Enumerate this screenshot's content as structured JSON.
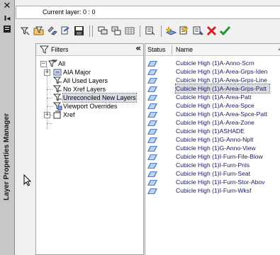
{
  "palette": {
    "title": "Layer Properties Manager"
  },
  "current_layer": "Current layer: 0 : 0",
  "toolbar": {
    "buttons": [
      "new-property-filter",
      "new-group-filter",
      "layer-states-manager",
      "new-layer",
      "new-layer-vp-frozen",
      "delete-layer",
      "set-current"
    ]
  },
  "filters": {
    "header": "Filters",
    "collapse": "«",
    "tree": [
      {
        "label": "All",
        "level": 0
      },
      {
        "label": "AIA Major",
        "level": 1
      },
      {
        "label": "All Used Layers",
        "level": 1
      },
      {
        "label": "No Xref Layers",
        "level": 1
      },
      {
        "label": "Unreconciled New Layers",
        "level": 1,
        "selected": true
      },
      {
        "label": "Viewport Overrides",
        "level": 1
      },
      {
        "label": "Xref",
        "level": 0
      }
    ]
  },
  "layers": {
    "columns": {
      "status": "Status",
      "name": "Name"
    },
    "rows": [
      {
        "name": "Cubicle High (1)A-Anno-Scrn"
      },
      {
        "name": "Cubicle High (1)A-Area-Grps-Iden"
      },
      {
        "name": "Cubicle High (1)A-Area-Grps-Line"
      },
      {
        "name": "Cubicle High (1)A-Area-Grps-Patt",
        "selected": true
      },
      {
        "name": "Cubicle High (1)A-Area-Patt"
      },
      {
        "name": "Cubicle High (1)A-Area-Spce"
      },
      {
        "name": "Cubicle High (1)A-Area-Spce-Patt"
      },
      {
        "name": "Cubicle High (1)A-Area-Zone"
      },
      {
        "name": "Cubicle High (1)ASHADE"
      },
      {
        "name": "Cubicle High (1)G-Anno-Nplt"
      },
      {
        "name": "Cubicle High (1)G-Anno-View"
      },
      {
        "name": "Cubicle High (1)I-Furn-File-Blow"
      },
      {
        "name": "Cubicle High (1)I-Furn-Pnls"
      },
      {
        "name": "Cubicle High (1)I-Furn-Seat"
      },
      {
        "name": "Cubicle High (1)I-Furn-Stor-Abov"
      },
      {
        "name": "Cubicle High (1)I-Furn-Wksf"
      }
    ]
  },
  "colors": {
    "status_icon": "#4a7fd0",
    "selection": "#d9dce3"
  }
}
